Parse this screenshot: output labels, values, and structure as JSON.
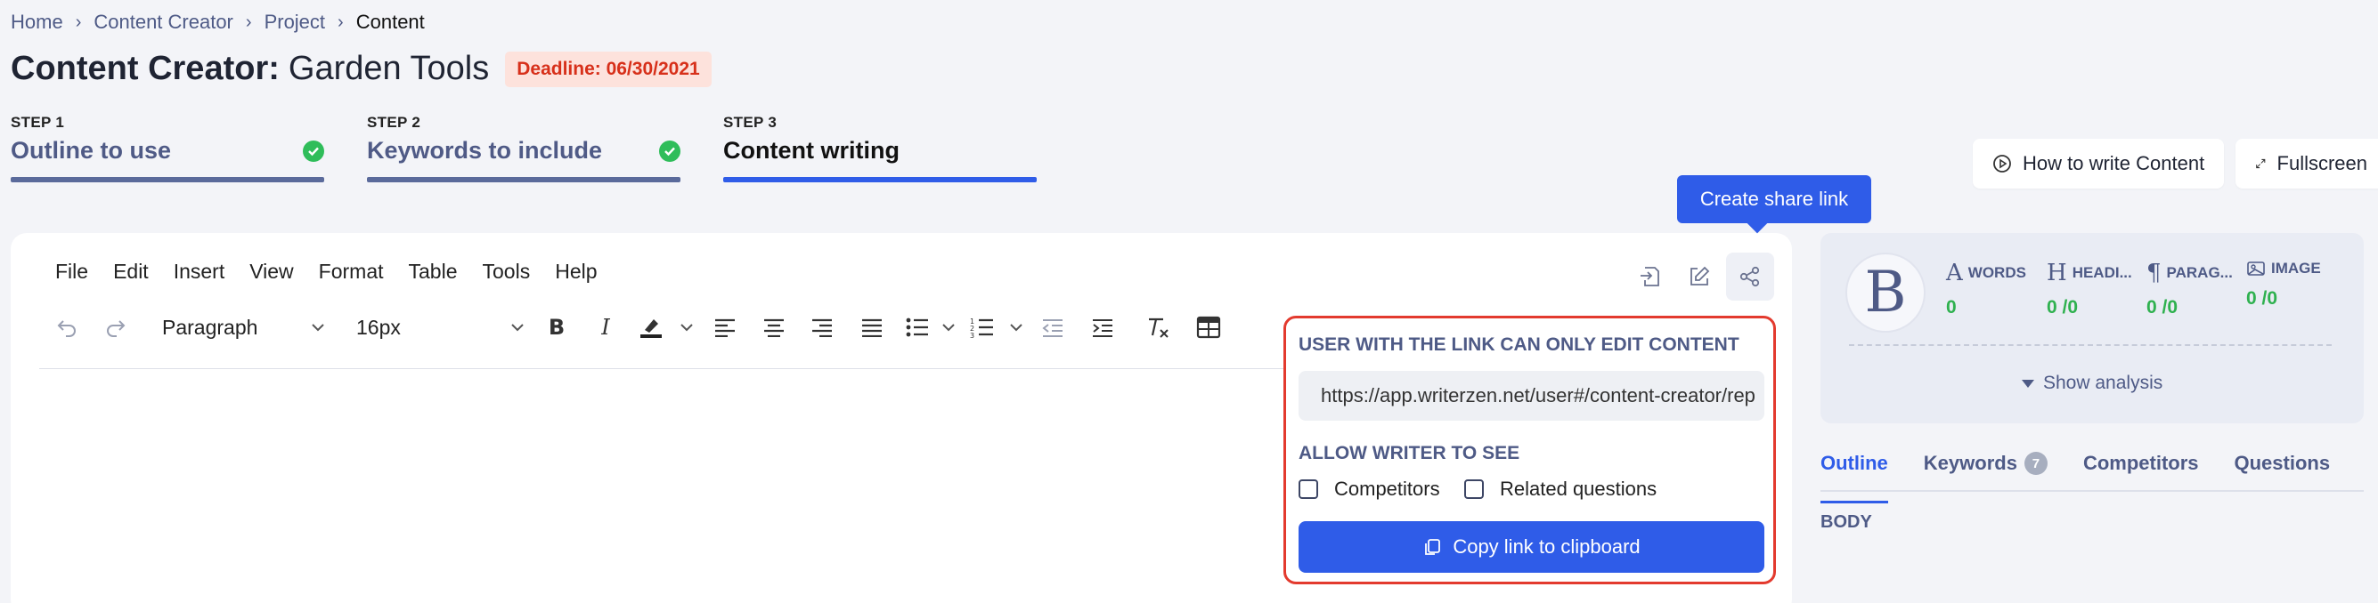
{
  "breadcrumb": {
    "items": [
      "Home",
      "Content Creator",
      "Project"
    ],
    "current": "Content",
    "separator": "›"
  },
  "title": {
    "prefix": "Content Creator:",
    "name": "Garden Tools",
    "deadline": "Deadline: 06/30/2021"
  },
  "steps": [
    {
      "num": "STEP 1",
      "label": "Outline to use",
      "done": true
    },
    {
      "num": "STEP 2",
      "label": "Keywords to include",
      "done": true
    },
    {
      "num": "STEP 3",
      "label": "Content writing",
      "done": false
    }
  ],
  "top_buttons": {
    "how_to": "How to write Content",
    "fullscreen": "Fullscreen"
  },
  "tooltip": "Create share link",
  "menubar": [
    "File",
    "Edit",
    "Insert",
    "View",
    "Format",
    "Table",
    "Tools",
    "Help"
  ],
  "toolbar": {
    "block_format": "Paragraph",
    "font_size": "16px"
  },
  "share_popover": {
    "heading": "USER WITH THE LINK CAN ONLY EDIT CONTENT",
    "link": "https://app.writerzen.net/user#/content-creator/rep",
    "allow_heading": "ALLOW WRITER TO SEE",
    "options": [
      "Competitors",
      "Related questions"
    ],
    "copy_label": "Copy link to clipboard"
  },
  "analysis": {
    "avatar_letter": "B",
    "metrics": [
      {
        "icon": "A",
        "label": "WORDS",
        "value": "0"
      },
      {
        "icon": "H",
        "label": "HEADI...",
        "value": "0 /0"
      },
      {
        "icon": "¶",
        "label": "PARAG...",
        "value": "0 /0"
      },
      {
        "icon": "img",
        "label": "IMAGE",
        "value": "0 /0"
      }
    ],
    "show_analysis": "Show analysis"
  },
  "right_tabs": {
    "outline": "Outline",
    "keywords": "Keywords",
    "keywords_count": "7",
    "competitors": "Competitors",
    "questions": "Questions"
  },
  "body_label": "BODY",
  "colors": {
    "accent": "#2f5ce8",
    "success": "#2fbd5a",
    "danger": "#e33a2e",
    "muted": "#4e5a86"
  }
}
